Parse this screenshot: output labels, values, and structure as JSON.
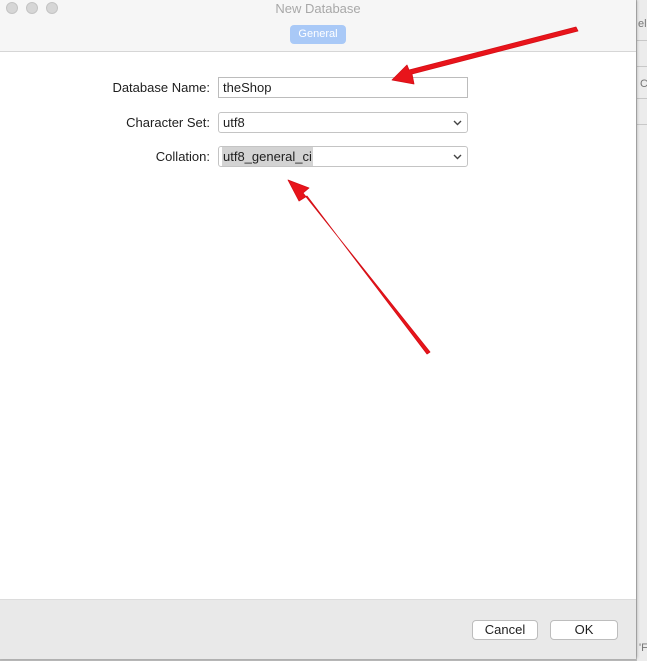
{
  "window": {
    "title": "New Database"
  },
  "tabs": [
    {
      "label": "General",
      "selected": true
    }
  ],
  "form": {
    "database_name": {
      "label": "Database Name:",
      "value": "theShop"
    },
    "character_set": {
      "label": "Character Set:",
      "value": "utf8"
    },
    "collation": {
      "label": "Collation:",
      "value": "utf8_general_ci"
    }
  },
  "buttons": {
    "cancel": "Cancel",
    "ok": "OK"
  },
  "background_window": {
    "fragment_1": "el",
    "fragment_2": "C",
    "fragment_3": "'F"
  },
  "colors": {
    "tab_selected": "#a9c9f7",
    "annotation_arrow": "#e8141b",
    "selection_highlight": "#d3d3d3"
  },
  "icons": {
    "select_toggle": "chevron-down-icon",
    "window_controls": [
      "close-icon",
      "minimize-icon",
      "zoom-icon"
    ]
  }
}
